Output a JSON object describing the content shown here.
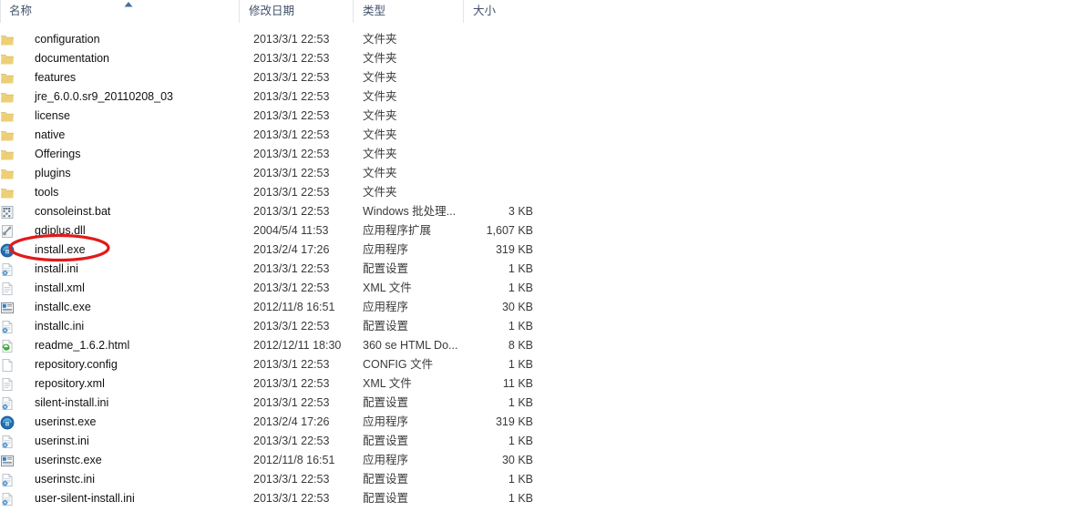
{
  "window": {
    "type": "windows-explorer-file-list",
    "sort_column": "名称",
    "sort_direction": "ascending",
    "sort_icon": "sort-ascending-arrow-icon"
  },
  "columns": {
    "name": "名称",
    "date_modified": "修改日期",
    "type": "类型",
    "size": "大小"
  },
  "annotation": {
    "shape": "ellipse",
    "color": "#e01b1b",
    "target": "install.exe",
    "name": "red-ellipse-annotation"
  },
  "rows": [
    {
      "icon": "folder-icon",
      "name": "configuration",
      "date": "2013/3/1 22:53",
      "type": "文件夹",
      "size": ""
    },
    {
      "icon": "folder-icon",
      "name": "documentation",
      "date": "2013/3/1 22:53",
      "type": "文件夹",
      "size": ""
    },
    {
      "icon": "folder-icon",
      "name": "features",
      "date": "2013/3/1 22:53",
      "type": "文件夹",
      "size": ""
    },
    {
      "icon": "folder-icon",
      "name": "jre_6.0.0.sr9_20110208_03",
      "date": "2013/3/1 22:53",
      "type": "文件夹",
      "size": ""
    },
    {
      "icon": "folder-icon",
      "name": "license",
      "date": "2013/3/1 22:53",
      "type": "文件夹",
      "size": ""
    },
    {
      "icon": "folder-icon",
      "name": "native",
      "date": "2013/3/1 22:53",
      "type": "文件夹",
      "size": ""
    },
    {
      "icon": "folder-icon",
      "name": "Offerings",
      "date": "2013/3/1 22:53",
      "type": "文件夹",
      "size": ""
    },
    {
      "icon": "folder-icon",
      "name": "plugins",
      "date": "2013/3/1 22:53",
      "type": "文件夹",
      "size": ""
    },
    {
      "icon": "folder-icon",
      "name": "tools",
      "date": "2013/3/1 22:53",
      "type": "文件夹",
      "size": ""
    },
    {
      "icon": "batch-file-icon",
      "name": "consoleinst.bat",
      "date": "2013/3/1 22:53",
      "type": "Windows 批处理...",
      "size": "3 KB"
    },
    {
      "icon": "dll-file-icon",
      "name": "gdiplus.dll",
      "date": "2004/5/4 11:53",
      "type": "应用程序扩展",
      "size": "1,607 KB"
    },
    {
      "icon": "installer-exe-icon",
      "name": "install.exe",
      "date": "2013/2/4 17:26",
      "type": "应用程序",
      "size": "319 KB"
    },
    {
      "icon": "ini-file-icon",
      "name": "install.ini",
      "date": "2013/3/1 22:53",
      "type": "配置设置",
      "size": "1 KB"
    },
    {
      "icon": "xml-file-icon",
      "name": "install.xml",
      "date": "2013/3/1 22:53",
      "type": "XML 文件",
      "size": "1 KB"
    },
    {
      "icon": "application-icon",
      "name": "installc.exe",
      "date": "2012/11/8 16:51",
      "type": "应用程序",
      "size": "30 KB"
    },
    {
      "icon": "ini-file-icon",
      "name": "installc.ini",
      "date": "2013/3/1 22:53",
      "type": "配置设置",
      "size": "1 KB"
    },
    {
      "icon": "html-file-icon",
      "name": "readme_1.6.2.html",
      "date": "2012/12/11 18:30",
      "type": "360 se HTML Do...",
      "size": "8 KB"
    },
    {
      "icon": "generic-file-icon",
      "name": "repository.config",
      "date": "2013/3/1 22:53",
      "type": "CONFIG 文件",
      "size": "1 KB"
    },
    {
      "icon": "xml-file-icon",
      "name": "repository.xml",
      "date": "2013/3/1 22:53",
      "type": "XML 文件",
      "size": "11 KB"
    },
    {
      "icon": "ini-file-icon",
      "name": "silent-install.ini",
      "date": "2013/3/1 22:53",
      "type": "配置设置",
      "size": "1 KB"
    },
    {
      "icon": "installer-exe-icon",
      "name": "userinst.exe",
      "date": "2013/2/4 17:26",
      "type": "应用程序",
      "size": "319 KB"
    },
    {
      "icon": "ini-file-icon",
      "name": "userinst.ini",
      "date": "2013/3/1 22:53",
      "type": "配置设置",
      "size": "1 KB"
    },
    {
      "icon": "application-icon",
      "name": "userinstc.exe",
      "date": "2012/11/8 16:51",
      "type": "应用程序",
      "size": "30 KB"
    },
    {
      "icon": "ini-file-icon",
      "name": "userinstc.ini",
      "date": "2013/3/1 22:53",
      "type": "配置设置",
      "size": "1 KB"
    },
    {
      "icon": "ini-file-icon",
      "name": "user-silent-install.ini",
      "date": "2013/3/1 22:53",
      "type": "配置设置",
      "size": "1 KB"
    }
  ]
}
